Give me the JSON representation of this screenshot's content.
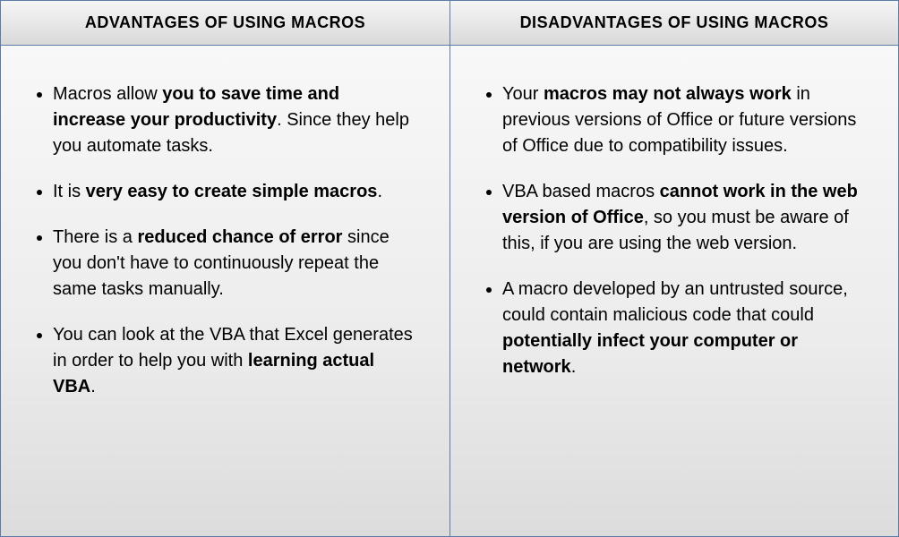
{
  "columns": [
    {
      "header": "ADVANTAGES OF USING MACROS",
      "items": [
        [
          {
            "t": "Macros allow ",
            "b": false
          },
          {
            "t": "you to save time and increase your productivity",
            "b": true
          },
          {
            "t": ". Since they help you automate tasks.",
            "b": false
          }
        ],
        [
          {
            "t": "It is ",
            "b": false
          },
          {
            "t": "very easy to create simple macros",
            "b": true
          },
          {
            "t": ".",
            "b": false
          }
        ],
        [
          {
            "t": "There is a ",
            "b": false
          },
          {
            "t": "reduced chance of error",
            "b": true
          },
          {
            "t": " since you don't have to continuously repeat the same tasks manually.",
            "b": false
          }
        ],
        [
          {
            "t": "You can look at the VBA that Excel generates in order to help you with ",
            "b": false
          },
          {
            "t": "learning actual VBA",
            "b": true
          },
          {
            "t": ".",
            "b": false
          }
        ]
      ]
    },
    {
      "header": "DISADVANTAGES OF USING MACROS",
      "items": [
        [
          {
            "t": "Your ",
            "b": false
          },
          {
            "t": "macros may not always work",
            "b": true
          },
          {
            "t": " in previous versions of Office or future versions of Office due to compatibility issues.",
            "b": false
          }
        ],
        [
          {
            "t": "VBA based macros ",
            "b": false
          },
          {
            "t": "cannot work in the web version of Office",
            "b": true
          },
          {
            "t": ", so you must be aware of this, if you are using the web version.",
            "b": false
          }
        ],
        [
          {
            "t": "A macro developed by an untrusted source, could contain malicious code that could ",
            "b": false
          },
          {
            "t": "potentially infect your computer or network",
            "b": true
          },
          {
            "t": ".",
            "b": false
          }
        ]
      ]
    }
  ]
}
